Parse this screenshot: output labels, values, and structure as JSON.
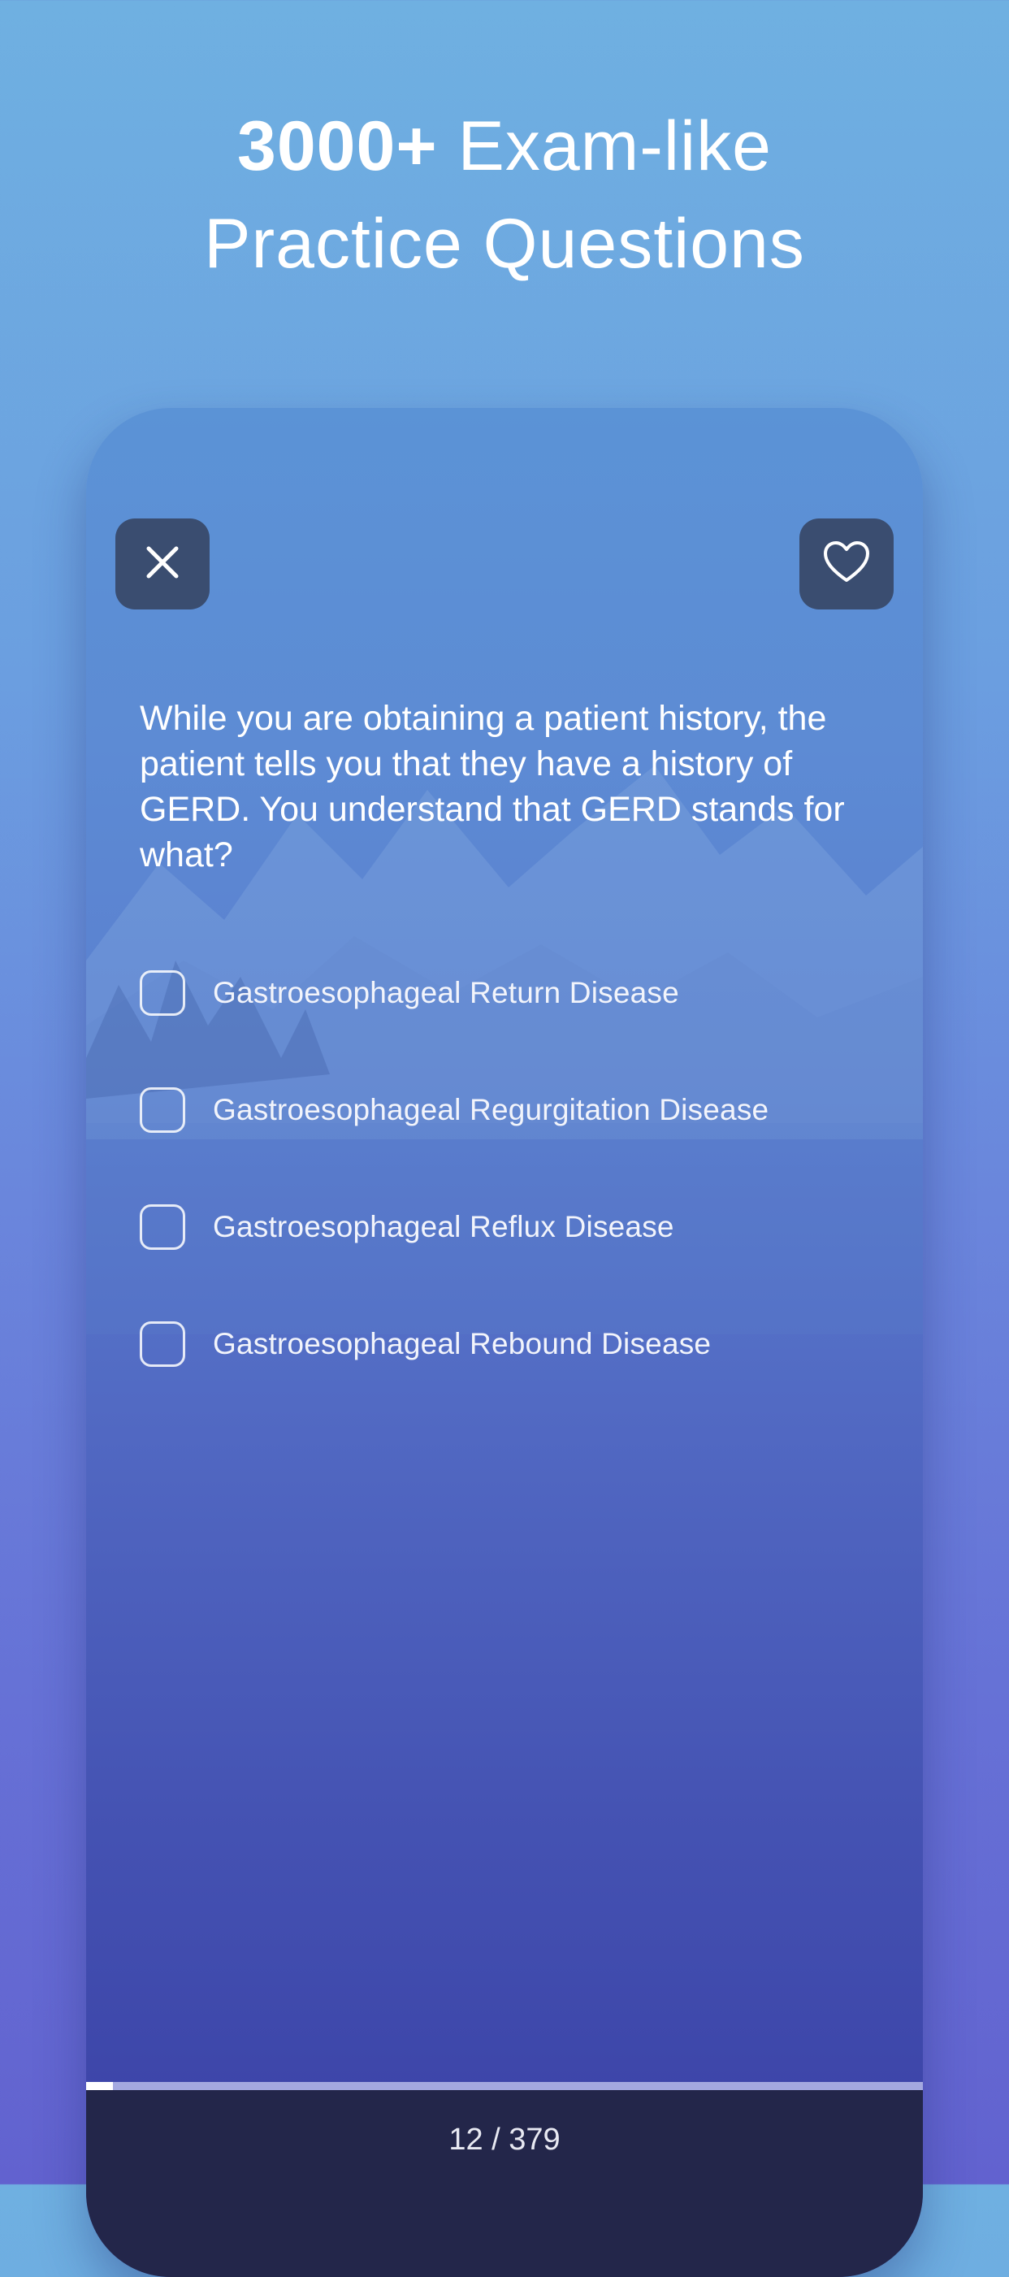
{
  "headline": {
    "bold": "3000+",
    "line1_rest": " Exam-like",
    "line2": "Practice Questions"
  },
  "toolbar": {
    "close_icon": "close-icon",
    "favorite_icon": "heart-icon"
  },
  "question": {
    "text": "While you are obtaining a patient history, the patient tells you that they have a history of GERD. You understand that GERD stands for what?"
  },
  "options": [
    {
      "label": "Gastroesophageal Return Disease",
      "checked": false
    },
    {
      "label": "Gastroesophageal Regurgitation Disease",
      "checked": false
    },
    {
      "label": "Gastroesophageal Reflux Disease",
      "checked": false
    },
    {
      "label": "Gastroesophageal Rebound Disease",
      "checked": false
    }
  ],
  "progress": {
    "current": 12,
    "total": 379,
    "label": "12 / 379"
  },
  "colors": {
    "button_bg": "#3a4d70",
    "footer_bg": "#23264a",
    "progress_track": "#a4a9e0",
    "progress_fill": "#ffffff"
  }
}
